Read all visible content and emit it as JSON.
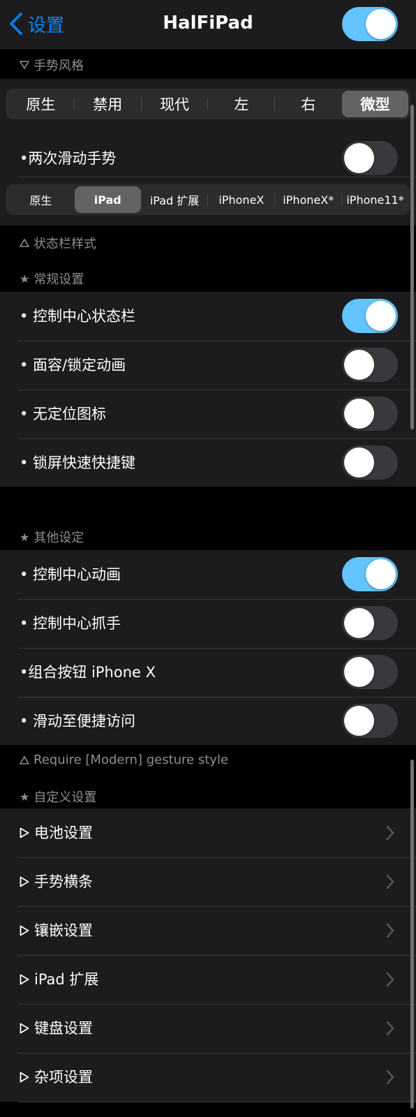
{
  "nav": {
    "back_label": "设置",
    "title": "HalFiPad",
    "enabled": true
  },
  "gesture": {
    "header": "手势风格",
    "segments": [
      "原生",
      "禁用",
      "现代",
      "左",
      "右",
      "微型"
    ],
    "selected_index": 5,
    "twice_swipe": {
      "label": "•两次滑动手势",
      "on": false
    },
    "device_segments": [
      "原生",
      "iPad",
      "iPad 扩展",
      "iPhoneX",
      "iPhoneX*",
      "iPhone11*"
    ],
    "device_selected_index": 1
  },
  "statusbar_header": "状态栏样式",
  "general": {
    "header": "常规设置",
    "rows": [
      {
        "label": "• 控制中心状态栏",
        "on": true
      },
      {
        "label": "• 面容/锁定动画",
        "on": false
      },
      {
        "label": "• 无定位图标",
        "on": false
      },
      {
        "label": "• 锁屏快速快捷键",
        "on": false
      }
    ]
  },
  "other": {
    "header": "其他设定",
    "rows": [
      {
        "label": "• 控制中心动画",
        "on": true
      },
      {
        "label": "• 控制中心抓手",
        "on": false
      },
      {
        "label": "•组合按钮 iPhone X",
        "on": false
      },
      {
        "label": "• 滑动至便捷访问",
        "on": false
      }
    ],
    "footer": "Require [Modern] gesture style"
  },
  "custom": {
    "header": "自定义设置",
    "rows": [
      {
        "label": "电池设置"
      },
      {
        "label": "手势横条"
      },
      {
        "label": "镶嵌设置"
      },
      {
        "label": "iPad 扩展"
      },
      {
        "label": "键盘设置"
      },
      {
        "label": "杂项设置"
      }
    ]
  },
  "colors": {
    "accent": "#0a84ff",
    "toggle_on": "#64c4ff",
    "toggle_off": "#39393d",
    "cell_bg": "#1c1c1e",
    "header_text": "#8e8e93"
  },
  "icons": {
    "back": "chevron-left-icon",
    "collapse": "triangle-down-icon",
    "expand": "triangle-up-icon",
    "star": "star-icon",
    "play": "triangle-right-icon",
    "disclosure": "chevron-right-icon"
  }
}
